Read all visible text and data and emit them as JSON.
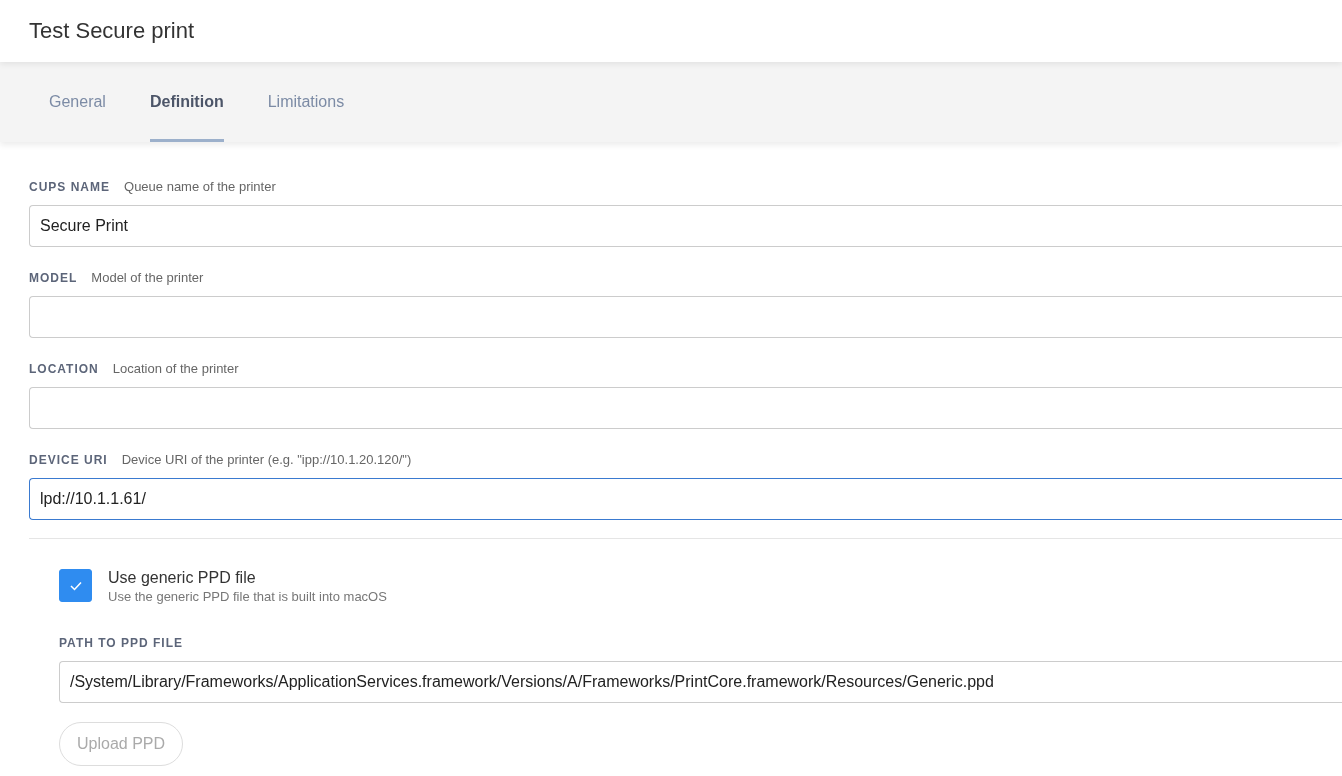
{
  "title": "Test Secure print",
  "tabs": [
    {
      "label": "General",
      "selected": false
    },
    {
      "label": "Definition",
      "selected": true
    },
    {
      "label": "Limitations",
      "selected": false
    }
  ],
  "fields": [
    {
      "label": "CUPS NAME",
      "hint": "Queue name of the printer",
      "value": "Secure Print",
      "focused": false
    },
    {
      "label": "MODEL",
      "hint": "Model of the printer",
      "focused": false
    },
    {
      "label": "LOCATION",
      "hint": "Location of the printer",
      "focused": false
    },
    {
      "label": "DEVICE URI",
      "hint": "Device URI of the printer (e.g. \"ipp://10.1.20.120/\")",
      "value": "lpd://10.1.1.61/",
      "focused": true
    }
  ],
  "generic_ppd": {
    "label": "Use generic PPD file",
    "description": "Use the generic PPD file that is built into macOS",
    "checked": true
  },
  "ppd_path": {
    "label": "PATH TO PPD FILE",
    "value": "/System/Library/Frameworks/ApplicationServices.framework/Versions/A/Frameworks/PrintCore.framework/Resources/Generic.ppd"
  },
  "upload_button": {
    "label": "Upload PPD",
    "disabled": true
  }
}
